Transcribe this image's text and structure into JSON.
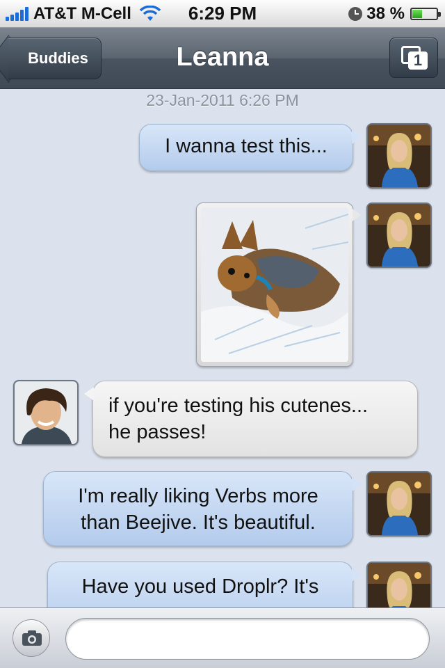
{
  "status_bar": {
    "carrier": "AT&T M-Cell",
    "time": "6:29 PM",
    "battery": "38 %",
    "battery_level": 0.38,
    "signal_bars": 5,
    "icons": [
      "signal-icon",
      "wifi-icon",
      "clock-icon",
      "battery-icon"
    ]
  },
  "nav": {
    "back_label": "Buddies",
    "title": "Leanna",
    "windows_count": "1"
  },
  "chat": {
    "timestamp": "23-Jan-2011 6:26 PM",
    "messages": [
      {
        "sender": "me",
        "type": "text",
        "lines": [
          "I wanna test this..."
        ]
      },
      {
        "sender": "me",
        "type": "photo"
      },
      {
        "sender": "buddy",
        "type": "text",
        "lines": [
          "if you're testing his cutenes...",
          "he passes!"
        ]
      },
      {
        "sender": "me",
        "type": "text",
        "lines": [
          "I'm really liking Verbs more",
          "than Beejive. It's beautiful."
        ]
      },
      {
        "sender": "me",
        "type": "text",
        "lines": [
          "Have you used Droplr? It's"
        ]
      }
    ]
  },
  "input_bar": {
    "placeholder": "",
    "camera_icon": "camera-icon"
  },
  "colors": {
    "chat_background": "#dbe2ed",
    "outgoing_bubble": "#c4d8f2",
    "incoming_bubble": "#ececec",
    "nav_bar": "#505a66"
  }
}
